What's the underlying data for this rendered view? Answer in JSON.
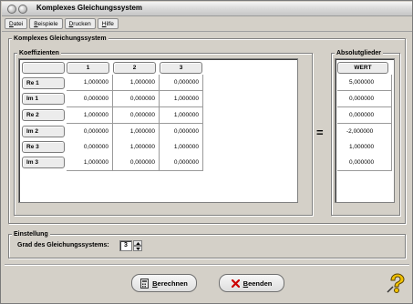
{
  "window": {
    "title": "Komplexes Gleichungssystem"
  },
  "menu": [
    {
      "first": "D",
      "rest": "atei"
    },
    {
      "first": "B",
      "rest": "eispiele"
    },
    {
      "first": "D",
      "rest": "rucken"
    },
    {
      "first": "H",
      "rest": "ilfe"
    }
  ],
  "main_group": {
    "label": "Komplexes Gleichungssystem"
  },
  "coefficients": {
    "label": "Koeffizienten",
    "column_headers": [
      "",
      "1",
      "2",
      "3"
    ],
    "rows": [
      {
        "label": "Re 1",
        "values": [
          "1,000000",
          "1,000000",
          "0,000000"
        ]
      },
      {
        "label": "Im 1",
        "values": [
          "0,000000",
          "0,000000",
          "1,000000"
        ]
      },
      {
        "label": "Re 2",
        "values": [
          "1,000000",
          "0,000000",
          "1,000000"
        ]
      },
      {
        "label": "Im 2",
        "values": [
          "0,000000",
          "1,000000",
          "0,000000"
        ]
      },
      {
        "label": "Re 3",
        "values": [
          "0,000000",
          "1,000000",
          "1,000000"
        ]
      },
      {
        "label": "Im 3",
        "values": [
          "1,000000",
          "0,000000",
          "0,000000"
        ]
      }
    ]
  },
  "equals_sign": "=",
  "absolute": {
    "label": "Absolutglieder",
    "header": "WERT",
    "values": [
      "5,000000",
      "0,000000",
      "0,000000",
      "-2,000000",
      "1,000000",
      "0,000000"
    ]
  },
  "setting": {
    "label": "Einstellung",
    "degree_label": "Grad des Gleichungssystems:",
    "degree_value": "3"
  },
  "buttons": {
    "calculate": {
      "first": "B",
      "rest": "erechnen"
    },
    "quit": {
      "first": "B",
      "rest": "eenden"
    }
  },
  "colors": {
    "window_bg": "#d4d0c8",
    "quit_icon": "#cc0000",
    "help_icon": "#f2c200"
  }
}
